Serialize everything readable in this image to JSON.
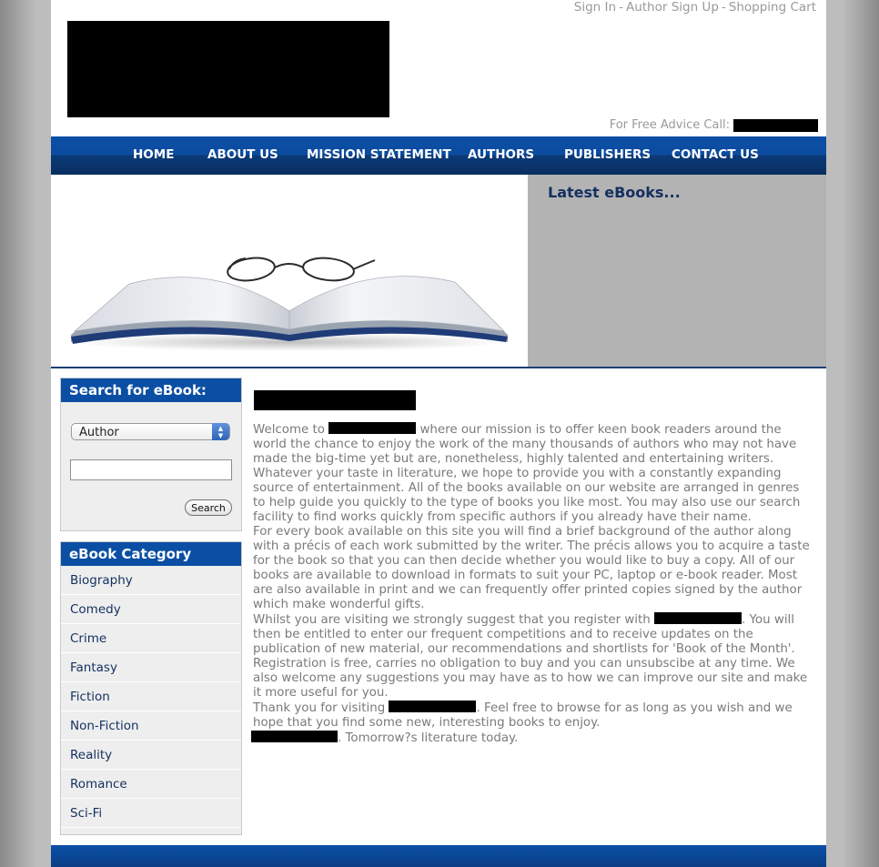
{
  "header": {
    "links": [
      "Sign In",
      "Author Sign Up",
      "Shopping Cart"
    ],
    "separator": "-",
    "advice_label": "For Free Advice Call:"
  },
  "nav": {
    "items": [
      "HOME",
      "ABOUT US",
      "MISSION STATEMENT",
      "AUTHORS",
      "PUBLISHERS",
      "CONTACT US"
    ]
  },
  "hero": {
    "latest_title": "Latest eBooks..."
  },
  "search": {
    "title": "Search for eBook:",
    "select_value": "Author",
    "input_value": "",
    "button_label": "Search"
  },
  "categories": {
    "title": "eBook Category",
    "items": [
      "Biography",
      "Comedy",
      "Crime",
      "Fantasy",
      "Fiction",
      "Non-Fiction",
      "Reality",
      "Romance",
      "Sci-Fi"
    ]
  },
  "content": {
    "p1_a": "Welcome to ",
    "p1_b": " where our mission is to offer keen book readers around the world the chance to enjoy the work of the many thousands of authors who may not have made the big-time yet but are, nonetheless, highly talented and entertaining writers.",
    "p2": "Whatever your taste in literature, we hope to provide you with a constantly expanding source of entertainment. All of the books available on our website are arranged in genres to help guide you quickly to the type of books you like most. You may also use our search facility to find works quickly from specific authors if you already have their name.",
    "p3": "For every book available on this site you will find a brief background of the author along with a précis of each work submitted by the writer. The précis allows you to acquire a taste for the book so that you can then decide whether you would like to buy a copy. All of our books are available to download in formats to suit your PC, laptop or e-book reader. Most are also available in print and we can frequently offer printed copies signed by the author which make wonderful gifts.",
    "p4_a": "Whilst you are visiting we strongly suggest that you register with ",
    "p4_b": ". You will then be entitled to enter our frequent competitions and to receive updates on the publication of new material, our recommendations and shortlists for 'Book of the Month'. Registration is free, carries no obligation to buy and you can unsubscibe at any time. We also welcome any suggestions you may have as to how we can improve our site and make it more useful for you.",
    "p5_a": "Thank you for visiting ",
    "p5_b": ". Feel free to browse for as long as you wish and we hope that you find some new, interesting books to enjoy.",
    "p6_b": ". Tomorrow?s literature today."
  },
  "colors": {
    "nav_blue": "#0b4fa6",
    "panel_head_blue": "#0a4fa3",
    "heading_navy": "#13305f",
    "body_text": "#7a7a7a",
    "latest_bg": "#b3b3b3"
  }
}
